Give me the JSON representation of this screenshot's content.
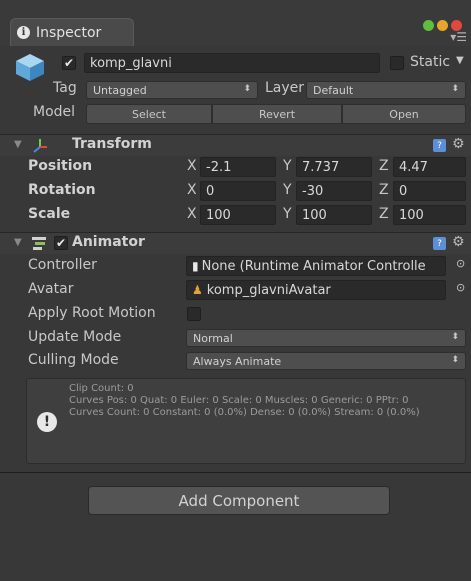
{
  "window": {
    "tab_title": "Inspector",
    "menu_glyph": "▾☰"
  },
  "object": {
    "active": true,
    "name": "komp_glavni",
    "static_label": "Static",
    "static_checked": false,
    "tag_label": "Tag",
    "tag_value": "Untagged",
    "layer_label": "Layer",
    "layer_value": "Default",
    "model_label": "Model",
    "model_buttons": [
      "Select",
      "Revert",
      "Open"
    ]
  },
  "transform": {
    "title": "Transform",
    "rows": [
      {
        "label": "Position",
        "x": "-2.1",
        "y": "7.737",
        "z": "4.47"
      },
      {
        "label": "Rotation",
        "x": "0",
        "y": "-30",
        "z": "0"
      },
      {
        "label": "Scale",
        "x": "100",
        "y": "100",
        "z": "100"
      }
    ],
    "axis_labels": [
      "X",
      "Y",
      "Z"
    ]
  },
  "animator": {
    "title": "Animator",
    "enabled": true,
    "controller_label": "Controller",
    "controller_value": "None (Runtime Animator Controlle",
    "avatar_label": "Avatar",
    "avatar_value": "komp_glavniAvatar",
    "root_motion_label": "Apply Root Motion",
    "root_motion_checked": false,
    "update_mode_label": "Update Mode",
    "update_mode_value": "Normal",
    "culling_mode_label": "Culling Mode",
    "culling_mode_value": "Always Animate",
    "info": {
      "line1": "Clip Count: 0",
      "line2": "Curves Pos: 0 Quat: 0 Euler: 0 Scale: 0 Muscles: 0 Generic: 0 PPtr: 0",
      "line3": "Curves Count: 0 Constant: 0 (0.0%) Dense: 0 (0.0%) Stream: 0 (0.0%)"
    }
  },
  "add_component_label": "Add Component",
  "colors": {
    "panel": "#383838",
    "field": "#2a2a2a",
    "accent_blue": "#5c8fd6"
  },
  "icons": [
    "info-icon",
    "cube-icon",
    "transform-axis-icon",
    "animator-icon",
    "help-book-icon",
    "gear-icon",
    "object-picker-icon",
    "document-icon",
    "avatar-icon",
    "warning-icon"
  ]
}
